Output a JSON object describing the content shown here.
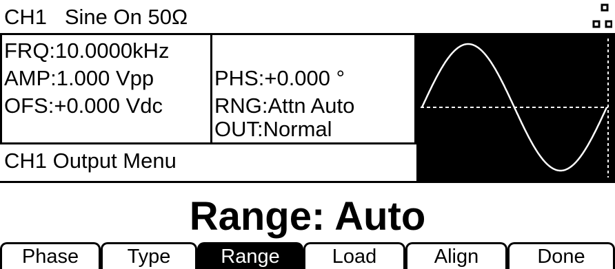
{
  "status_bar": {
    "channel": "CH1",
    "waveform": "Sine",
    "output_state": "On",
    "load": "50Ω",
    "title_text": "CH1   Sine On 50Ω"
  },
  "parameters_left": [
    {
      "label": "FRQ:",
      "value": "10.0000kHz",
      "text": "FRQ:10.0000kHz"
    },
    {
      "label": "AMP:",
      "value": "1.000 Vpp",
      "text": "AMP:1.000 Vpp"
    },
    {
      "label": "OFS:",
      "value": "+0.000 Vdc",
      "text": "OFS:+0.000 Vdc"
    }
  ],
  "parameters_right": [
    {
      "label": "PHS:",
      "value": "+0.000 °",
      "text": "PHS:+0.000 °"
    },
    {
      "label": "RNG:",
      "value": "Attn Auto",
      "text": "RNG:Attn Auto"
    },
    {
      "label": "OUT:",
      "value": "Normal",
      "text": "OUT:Normal"
    }
  ],
  "waveform_preview": {
    "type": "sine",
    "cycles": 1,
    "center_line": "dashed"
  },
  "menu": {
    "title": "CH1 Output Menu",
    "value_text": "Range: Auto"
  },
  "softkeys": [
    {
      "label": "Phase",
      "active": false
    },
    {
      "label": "Type",
      "active": false
    },
    {
      "label": "Range",
      "active": true
    },
    {
      "label": "Load",
      "active": false
    },
    {
      "label": "Align",
      "active": false
    },
    {
      "label": "Done",
      "active": false
    }
  ],
  "colors": {
    "foreground": "#000000",
    "background": "#ffffff"
  }
}
